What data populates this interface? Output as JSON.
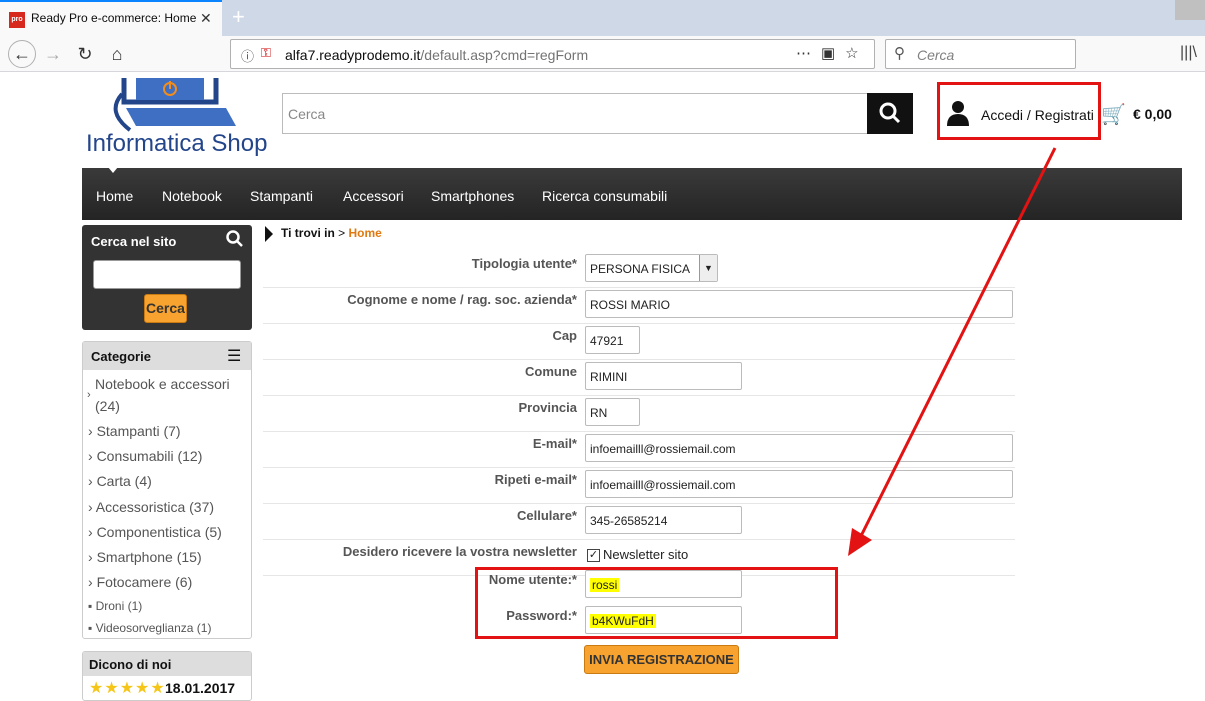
{
  "browser": {
    "tab_title": "Ready Pro e-commerce: Home",
    "tab_favicon": "pro",
    "url_host": "alfa7.readyprodemo.it",
    "url_path": "/default.asp?cmd=regForm",
    "search_placeholder": "Cerca"
  },
  "header": {
    "logo_text": "Informatica Shop",
    "search_placeholder": "Cerca",
    "login_label": "Accedi / Registrati",
    "cart_total": "€ 0,00"
  },
  "menu": {
    "items": [
      "Home",
      "Notebook",
      "Stampanti",
      "Accessori",
      "Smartphones",
      "Ricerca consumabili"
    ]
  },
  "sidebar": {
    "search_title": "Cerca nel sito",
    "search_button": "Cerca",
    "categories_title": "Categorie",
    "categories": [
      "Notebook e accessori",
      "(24)",
      "Stampanti (7)",
      "Consumabili (12)",
      "Carta (4)",
      "Accessoristica (37)",
      "Componentistica (5)",
      "Smartphone (15)",
      "Fotocamere (6)",
      "Droni (1)",
      "Videosorveglianza (1)"
    ],
    "reviews_title": "Dicono di noi",
    "review_date": "18.01.2017",
    "review_stars": 5
  },
  "breadcrumb": {
    "label": "Ti trovi in",
    "separator": ">",
    "current": "Home"
  },
  "form": {
    "tipologia_label": "Tipologia utente*",
    "tipologia_value": "PERSONA FISICA",
    "nome_label": "Cognome e nome / rag. soc. azienda*",
    "nome_value": "ROSSI MARIO",
    "cap_label": "Cap",
    "cap_value": "47921",
    "comune_label": "Comune",
    "comune_value": "RIMINI",
    "provincia_label": "Provincia",
    "provincia_value": "RN",
    "email_label": "E-mail*",
    "email_value": "infoemailll@rossiemail.com",
    "email2_label": "Ripeti e-mail*",
    "email2_value": "infoemailll@rossiemail.com",
    "cell_label": "Cellulare*",
    "cell_value": "345-26585214",
    "newsletter_label": "Desidero ricevere la vostra newsletter",
    "newsletter_option": "Newsletter sito",
    "username_label": "Nome utente:*",
    "username_value": "rossi",
    "password_label": "Password:*",
    "password_value": "b4KWuFdH",
    "submit_label": "INVIA REGISTRAZIONE"
  },
  "colors": {
    "annotation": "#e31313",
    "accent_orange": "#f8a22f",
    "menu_bg": "#2b2b2b",
    "logo_blue": "#23458a"
  }
}
